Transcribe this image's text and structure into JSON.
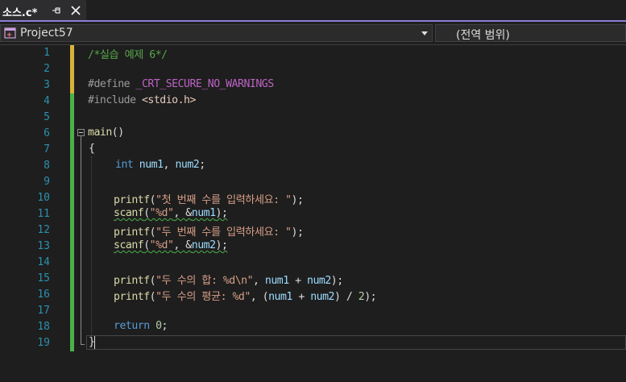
{
  "tab": {
    "title": "소스.c*",
    "pin_icon": "pin-icon",
    "close_icon": "close-icon"
  },
  "navbar": {
    "project": "Project57",
    "scope": "(전역 범위)"
  },
  "colors": {
    "accent": "#8f7dd8",
    "saved_change": "#4cb04c",
    "unsaved_change": "#d5b338",
    "line_number": "#2b91af"
  },
  "editor": {
    "lines": [
      {
        "n": "1",
        "t1": "/*실습 예제 6*/"
      },
      {
        "n": "2"
      },
      {
        "n": "3",
        "t1": "#define",
        "t2": "_CRT_SECURE_NO_WARNINGS"
      },
      {
        "n": "4",
        "t1": "#include",
        "t2": "<stdio.h>"
      },
      {
        "n": "5"
      },
      {
        "n": "6",
        "t1": "main",
        "t2": "()"
      },
      {
        "n": "7",
        "t1": "{"
      },
      {
        "n": "8",
        "t1": "int",
        "t2": "num1",
        "t3": ", ",
        "t4": "num2",
        "t5": ";"
      },
      {
        "n": "9"
      },
      {
        "n": "10",
        "t1": "printf",
        "t2": "(",
        "t3": "\"첫 번째 수를 입력하세요: \"",
        "t4": ");"
      },
      {
        "n": "11",
        "t1": "scanf",
        "t2": "(",
        "t3": "\"%d\"",
        "t4": ", &",
        "t5": "num1",
        "t6": ");"
      },
      {
        "n": "12",
        "t1": "printf",
        "t2": "(",
        "t3": "\"두 번째 수를 입력하세요: \"",
        "t4": ");"
      },
      {
        "n": "13",
        "t1": "scanf",
        "t2": "(",
        "t3": "\"%d\"",
        "t4": ", &",
        "t5": "num2",
        "t6": ");"
      },
      {
        "n": "14"
      },
      {
        "n": "15",
        "t1": "printf",
        "t2": "(",
        "t3": "\"두 수의 합: %d\\n\"",
        "t4": ", ",
        "t5": "num1",
        "t6": " + ",
        "t7": "num2",
        "t8": ");"
      },
      {
        "n": "16",
        "t1": "printf",
        "t2": "(",
        "t3": "\"두 수의 평균: %d\"",
        "t4": ", (",
        "t5": "num1",
        "t6": " + ",
        "t7": "num2",
        "t8": ") / ",
        "t9": "2",
        "t10": ");"
      },
      {
        "n": "17"
      },
      {
        "n": "18",
        "t1": "return",
        "t2": " ",
        "t3": "0",
        "t4": ";"
      },
      {
        "n": "19",
        "t1": "}"
      }
    ]
  }
}
